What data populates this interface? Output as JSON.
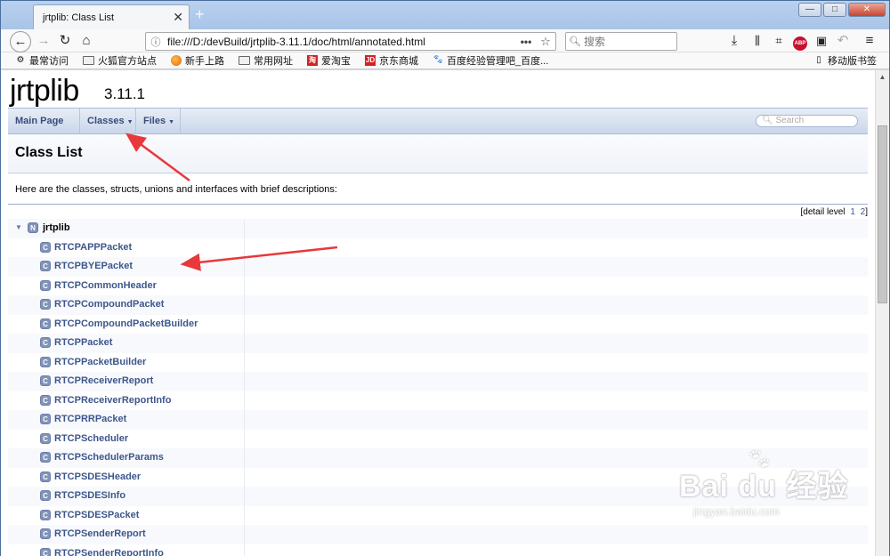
{
  "browser": {
    "tab_title": "jrtplib: Class List",
    "tab_close": "✕",
    "new_tab": "+",
    "url": "file:///D:/devBuild/jrtplib-3.11.1/doc/html/annotated.html",
    "search_placeholder": "搜索",
    "abp": "ABP",
    "window_buttons": {
      "min": "—",
      "max": "□",
      "close": "✕"
    }
  },
  "bookmarks": [
    {
      "label": "最常访问",
      "icon": "gear-icon"
    },
    {
      "label": "火狐官方站点",
      "icon": "folder-icon"
    },
    {
      "label": "新手上路",
      "icon": "firefox-icon"
    },
    {
      "label": "常用网址",
      "icon": "folder-icon"
    },
    {
      "label": "爱淘宝",
      "icon": "taobao-icon"
    },
    {
      "label": "京东商城",
      "icon": "jd-icon"
    },
    {
      "label": "百度经验管理吧_百度...",
      "icon": "baidu-paw-icon"
    }
  ],
  "bookmarks_mobile": "移动版书签",
  "doc": {
    "project_name": "jrtplib",
    "project_number": "3.11.1",
    "menu": [
      {
        "label": "Main Page",
        "has_caret": false
      },
      {
        "label": "Classes",
        "has_caret": true
      },
      {
        "label": "Files",
        "has_caret": true
      }
    ],
    "search_placeholder": "Search",
    "page_title": "Class List",
    "description": "Here are the classes, structs, unions and interfaces with brief descriptions:",
    "detail_level_label": "[detail level",
    "detail_levels": [
      "1",
      "2"
    ],
    "detail_close": "]",
    "namespace": {
      "badge": "N",
      "name": "jrtplib"
    },
    "classes": [
      "RTCPAPPPacket",
      "RTCPBYEPacket",
      "RTCPCommonHeader",
      "RTCPCompoundPacket",
      "RTCPCompoundPacketBuilder",
      "RTCPPacket",
      "RTCPPacketBuilder",
      "RTCPReceiverReport",
      "RTCPReceiverReportInfo",
      "RTCPRRPacket",
      "RTCPScheduler",
      "RTCPSchedulerParams",
      "RTCPSDESHeader",
      "RTCPSDESInfo",
      "RTCPSDESPacket",
      "RTCPSenderReport",
      "RTCPSenderReportInfo"
    ],
    "class_badge": "C"
  },
  "watermark": {
    "big": "Bai du 经验",
    "small": "jingyan.baidu.com"
  },
  "colors": {
    "link": "#3d578c",
    "annotation_arrow": "#e8383b",
    "menu_bg": "#c9d6ea"
  }
}
